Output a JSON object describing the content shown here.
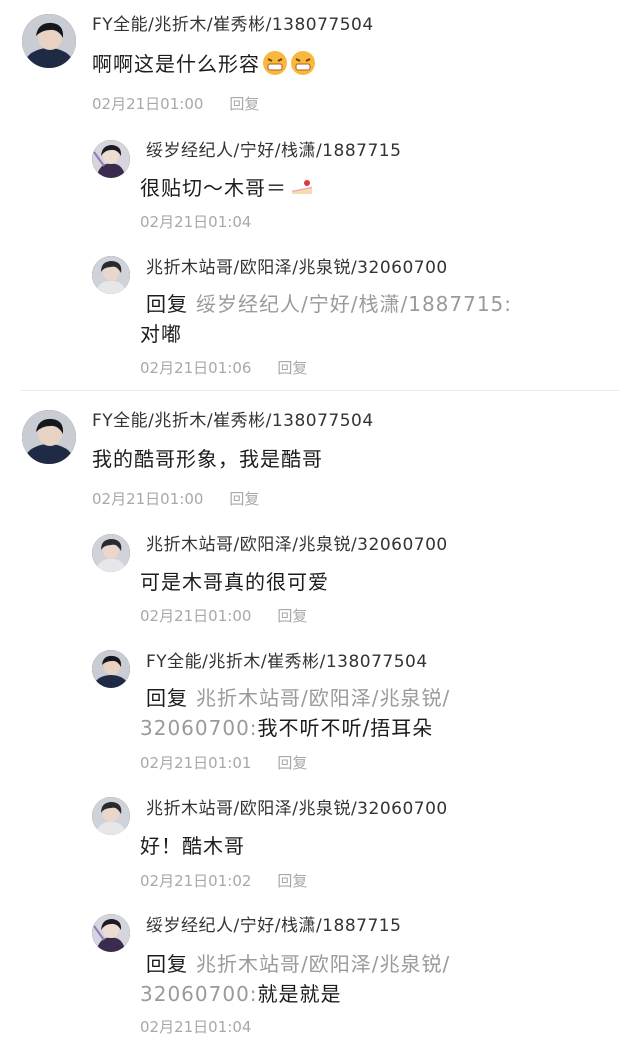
{
  "thread1": {
    "main": {
      "name": "FY全能/兆折木/崔秀彬/138077504",
      "text": "啊啊这是什么形容",
      "emoji": "grimacing-face-emoji",
      "time": "02月21日01:00",
      "reply": "回复"
    },
    "replies": [
      {
        "name": "绥岁经纪人/宁好/栈潇/1887715",
        "text": "很贴切～木哥＝",
        "emoji": "cake-emoji",
        "time": "02月21日01:04"
      },
      {
        "name": "兆折木站哥/欧阳泽/兆泉锐/32060700",
        "reply_word": "回复",
        "mention": "绥岁经纪人/宁好/栈潇/1887715:",
        "text": "对嘟",
        "time": "02月21日01:06",
        "reply": "回复"
      }
    ]
  },
  "thread2": {
    "main": {
      "name": "FY全能/兆折木/崔秀彬/138077504",
      "text": "我的酷哥形象，我是酷哥",
      "time": "02月21日01:00",
      "reply": "回复"
    },
    "replies": [
      {
        "name": "兆折木站哥/欧阳泽/兆泉锐/32060700",
        "text": "可是木哥真的很可爱",
        "time": "02月21日01:00",
        "reply": "回复"
      },
      {
        "name": "FY全能/兆折木/崔秀彬/138077504",
        "reply_word": "回复",
        "mention1": "兆折木站哥/欧阳泽/兆泉锐/",
        "mention2": "32060700:",
        "text": "我不听不听/捂耳朵",
        "time": "02月21日01:01",
        "reply": "回复"
      },
      {
        "name": "兆折木站哥/欧阳泽/兆泉锐/32060700",
        "text": "好！酷木哥",
        "time": "02月21日01:02",
        "reply": "回复"
      },
      {
        "name": "绥岁经纪人/宁好/栈潇/1887715",
        "reply_word": "回复",
        "mention1": "兆折木站哥/欧阳泽/兆泉锐/",
        "mention2": "32060700:",
        "text": "就是就是",
        "time": "02月21日01:04"
      }
    ]
  },
  "colors": {
    "name": "#333333",
    "text": "#1c1c1c",
    "muted": "#a8a8a8",
    "mention": "#9a9a9a"
  }
}
